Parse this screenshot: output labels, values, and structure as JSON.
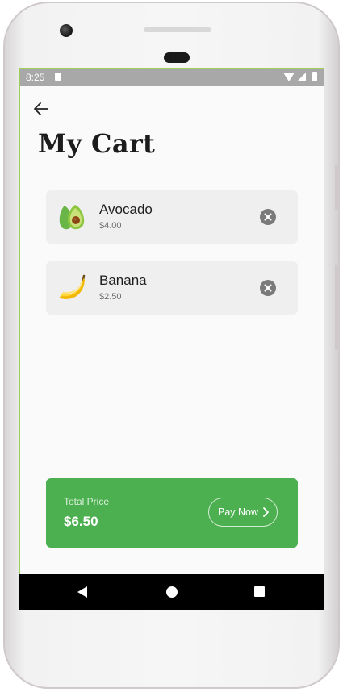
{
  "status_bar": {
    "time": "8:25"
  },
  "header": {
    "title": "My Cart"
  },
  "cart": {
    "items": [
      {
        "name": "Avocado",
        "price": "$4.00",
        "icon": "avocado-icon"
      },
      {
        "name": "Banana",
        "price": "$2.50",
        "icon": "banana-icon"
      }
    ]
  },
  "summary": {
    "total_label": "Total Price",
    "total_value": "$6.50",
    "pay_label": "Pay Now"
  },
  "colors": {
    "accent": "#4caf50",
    "card_background": "#efefef",
    "screen_background": "#fafafa"
  }
}
